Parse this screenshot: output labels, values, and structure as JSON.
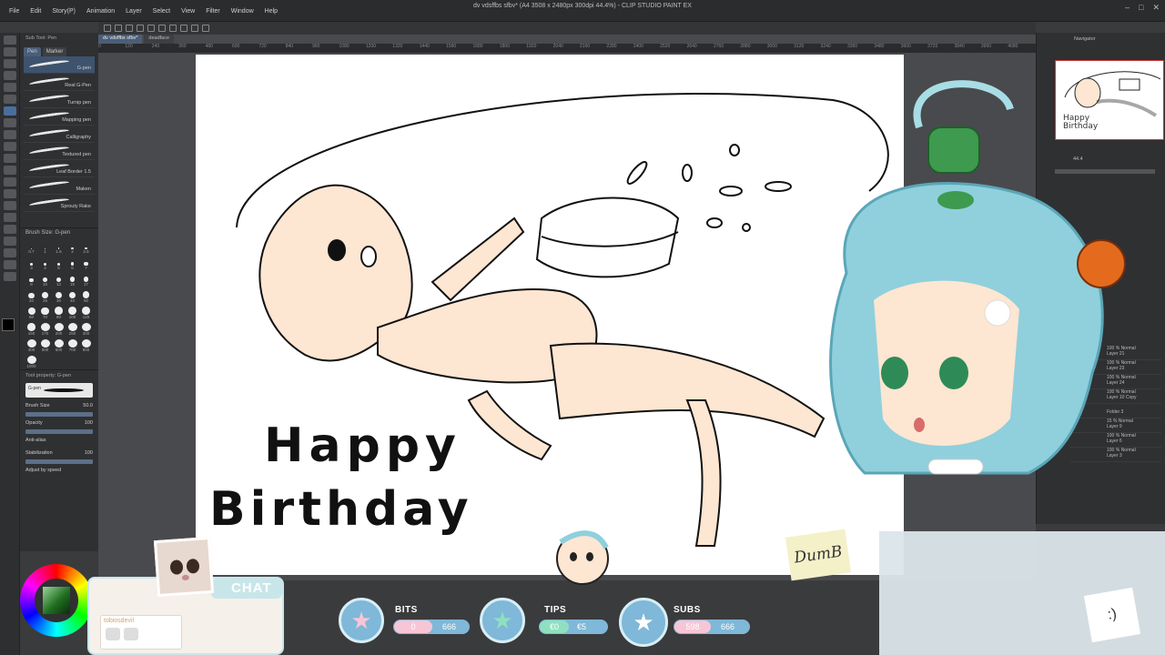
{
  "app": {
    "title": "dv vdsffbs sfbv* (A4 3508 x 2480px 300dpi 44.4%) - CLIP STUDIO PAINT EX",
    "menu": [
      "File",
      "Edit",
      "Story(P)",
      "Animation",
      "Layer",
      "Select",
      "View",
      "Filter",
      "Window",
      "Help"
    ]
  },
  "doc_tabs": [
    "dv vdsffbs sfbv*",
    "deadface"
  ],
  "subtool": {
    "tabs": [
      "Pen",
      "Marker"
    ],
    "header": "Sub Tool: Pen",
    "brushes": [
      "G-pen",
      "Real G-Pen",
      "Turnip pen",
      "Mapping pen",
      "Calligraphy",
      "Textured pen",
      "Leaf Border 1.5",
      "Maken",
      "Sprouty Rake"
    ]
  },
  "brush_size": {
    "header": "Brush Size: G-pen",
    "sizes": [
      "0.7",
      "1",
      "1.5",
      "2",
      "2.5",
      "3",
      "4",
      "5",
      "6",
      "7",
      "8",
      "10",
      "12",
      "15",
      "17",
      "20",
      "25",
      "30",
      "40",
      "50",
      "60",
      "70",
      "80",
      "100",
      "120",
      "150",
      "170",
      "200",
      "250",
      "300",
      "400",
      "500",
      "600",
      "700",
      "800",
      "1000"
    ]
  },
  "tool_property": {
    "header": "Tool property: G-pen",
    "current": "G-pen",
    "brush_size_label": "Brush Size",
    "brush_size_value": "50.0",
    "opacity_label": "Opacity",
    "opacity_value": "100",
    "antialias_label": "Anti-alias",
    "stabilization_label": "Stabilization",
    "stabilization_value": "100",
    "adjust_label": "Adjust by speed"
  },
  "ruler_ticks": [
    "0",
    "120",
    "240",
    "360",
    "480",
    "600",
    "720",
    "840",
    "960",
    "1080",
    "1200",
    "1320",
    "1440",
    "1560",
    "1680",
    "1800",
    "1920",
    "2040",
    "2160",
    "2280",
    "2400",
    "2520",
    "2640",
    "2760",
    "2880",
    "3000",
    "3120",
    "3240",
    "3360",
    "3480",
    "3600",
    "3720",
    "3840",
    "3960",
    "4080"
  ],
  "canvas": {
    "line1": "Happy",
    "line2": "Birthday"
  },
  "navigator": {
    "label": "Navigator",
    "zoom": "44.4",
    "thumb_text": "Happy Birthday"
  },
  "layers": [
    {
      "mode": "100 % Normal",
      "name": "Layer 21"
    },
    {
      "mode": "100 % Normal",
      "name": "Layer 23"
    },
    {
      "mode": "100 % Normal",
      "name": "Layer 24"
    },
    {
      "mode": "100 % Normal",
      "name": "Layer 10 Copy"
    },
    {
      "mode": "",
      "name": "Folder 3"
    },
    {
      "mode": "15 % Normal",
      "name": "Layer 9"
    },
    {
      "mode": "100 % Normal",
      "name": "Layer 6"
    },
    {
      "mode": "100 % Normal",
      "name": "Layer 3"
    }
  ],
  "overlay": {
    "chat_label": "CHAT",
    "chat_username": "tobiosdevil",
    "bits_label": "BITS",
    "bits_current": "0",
    "bits_goal": "666",
    "tips_label": "TIPS",
    "tips_current": "€0",
    "tips_goal": "€5",
    "subs_label": "SUBS",
    "subs_current": "598",
    "subs_goal": "666",
    "star": "★",
    "dumb_note": "DumB",
    "smile_note": ":)"
  },
  "colors": {
    "accent": "#7fb8d8",
    "pill_fill": "#f7c6d6",
    "tips_fill": "#8fe0c0",
    "skin": "#fde6d2",
    "hair": "#8fd0dc"
  }
}
